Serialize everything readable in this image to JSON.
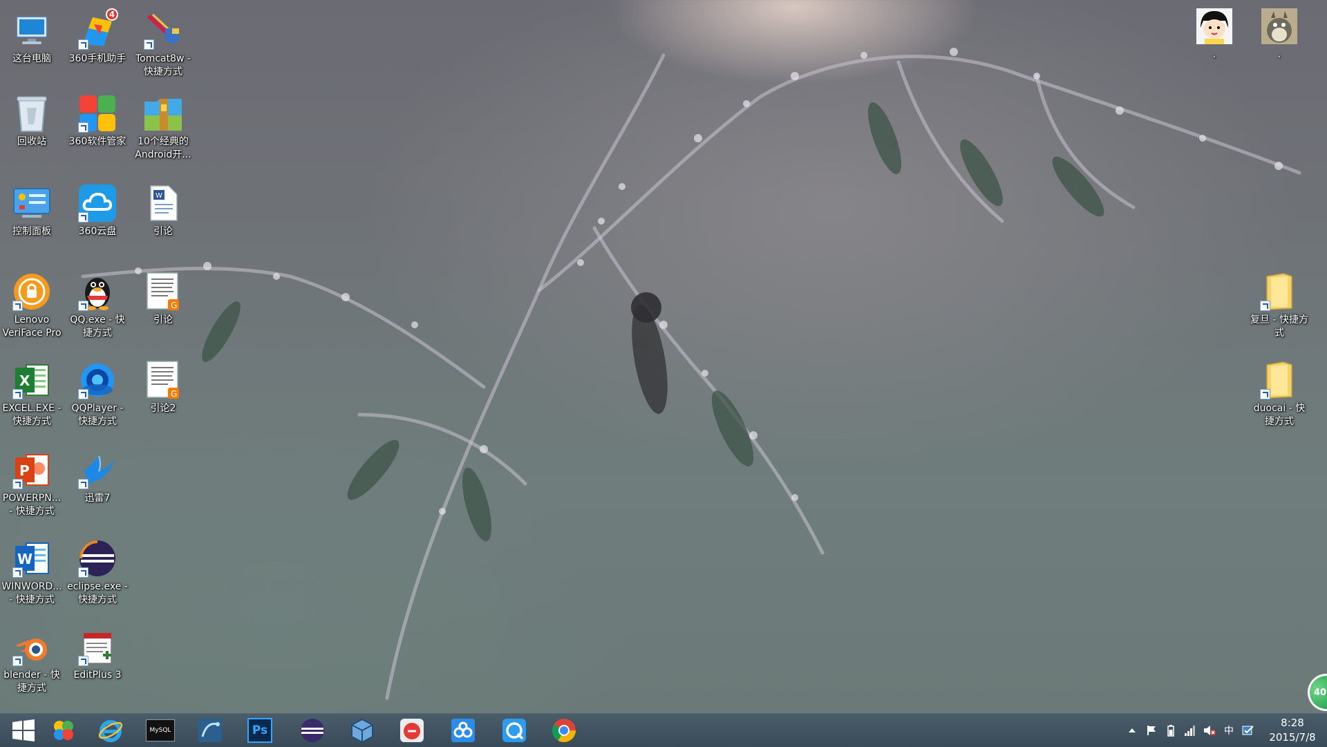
{
  "desktop": {
    "icons": [
      {
        "label": "这台电脑",
        "icon": "computer-icon"
      },
      {
        "label": "360手机助手",
        "icon": "360-phone-assistant-icon",
        "badge": "4"
      },
      {
        "label": "Tomcat8w -\n快捷方式",
        "icon": "tomcat-icon"
      },
      {
        "label": "回收站",
        "icon": "recycle-bin-icon"
      },
      {
        "label": "360软件管家",
        "icon": "360-software-manager-icon"
      },
      {
        "label": "10个经典的\nAndroid开...",
        "icon": "zip-archive-icon"
      },
      {
        "label": "控制面板",
        "icon": "control-panel-icon"
      },
      {
        "label": "360云盘",
        "icon": "360-cloud-icon"
      },
      {
        "label": "引论",
        "icon": "word-document-icon"
      },
      {
        "label": "Lenovo\nVeriFace Pro",
        "icon": "veriface-icon"
      },
      {
        "label": "QQ.exe - 快\n捷方式",
        "icon": "qq-penguin-icon"
      },
      {
        "label": "引论",
        "icon": "document-icon"
      },
      {
        "label": "EXCEL.EXE -\n快捷方式",
        "icon": "excel-icon"
      },
      {
        "label": "QQPlayer -\n快捷方式",
        "icon": "qqplayer-icon"
      },
      {
        "label": "引论2",
        "icon": "document-icon"
      },
      {
        "label": "POWERPN...\n- 快捷方式",
        "icon": "powerpoint-icon"
      },
      {
        "label": "迅雷7",
        "icon": "xunlei-icon"
      },
      {
        "label": "WINWORD...\n- 快捷方式",
        "icon": "word-icon"
      },
      {
        "label": "eclipse.exe -\n快捷方式",
        "icon": "eclipse-icon"
      },
      {
        "label": "blender - 快\n捷方式",
        "icon": "blender-icon"
      },
      {
        "label": "EditPlus 3",
        "icon": "editplus-icon"
      },
      {
        "label": ".",
        "icon": "cartoon-girl-icon"
      },
      {
        "label": ".",
        "icon": "totoro-icon"
      },
      {
        "label": "复旦 - 快捷方\n式",
        "icon": "folder-icon"
      },
      {
        "label": "duocai - 快\n捷方式",
        "icon": "folder-icon"
      }
    ]
  },
  "taskbar": {
    "apps": [
      {
        "name": "start-button"
      },
      {
        "name": "360-security-icon"
      },
      {
        "name": "internet-explorer-icon"
      },
      {
        "name": "mysql-icon",
        "text": "MySQL"
      },
      {
        "name": "mysql-workbench-icon"
      },
      {
        "name": "photoshop-icon",
        "text": "Ps"
      },
      {
        "name": "eclipse-icon"
      },
      {
        "name": "virtualbox-icon"
      },
      {
        "name": "music-app-icon"
      },
      {
        "name": "baidu-cloud-icon"
      },
      {
        "name": "qq-browser-icon"
      },
      {
        "name": "chrome-icon"
      }
    ],
    "tray": {
      "ime": "中",
      "time": "8:28",
      "date": "2015/7/8"
    }
  },
  "float_ball": {
    "text": "40"
  },
  "colors": {
    "taskbar": "#3f5565",
    "accent": "#2ea552"
  }
}
